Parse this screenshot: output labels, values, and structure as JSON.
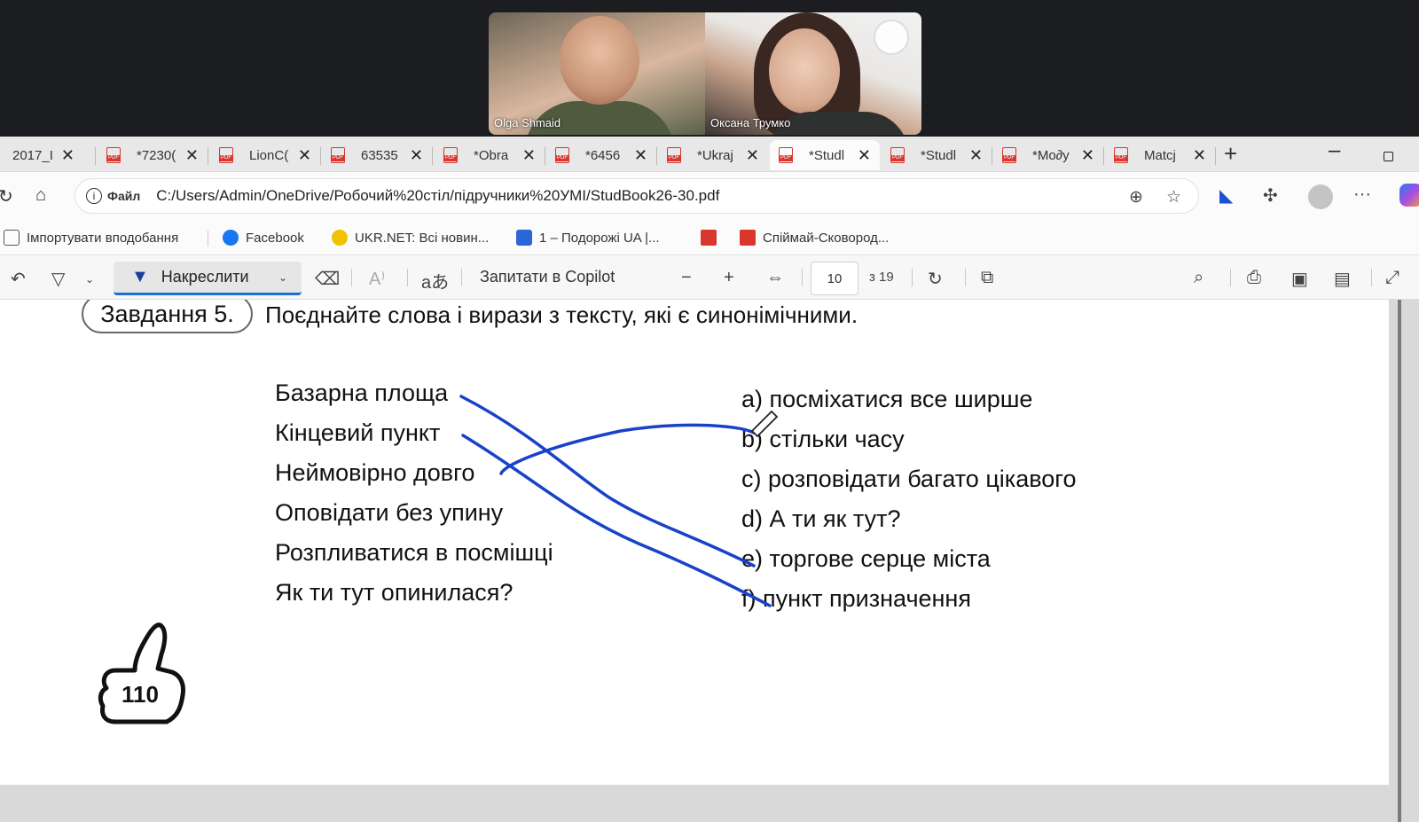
{
  "call": {
    "participants": [
      {
        "name": "Olga Shmaid"
      },
      {
        "name": "Оксана Трумко"
      }
    ]
  },
  "tabs": [
    {
      "label": "2017_І"
    },
    {
      "label": "*7230("
    },
    {
      "label": "LionC("
    },
    {
      "label": "63535"
    },
    {
      "label": "*Obra"
    },
    {
      "label": "*6456"
    },
    {
      "label": "*Ukraj"
    },
    {
      "label": "*Studl",
      "active": true
    },
    {
      "label": "*Studl"
    },
    {
      "label": "*Mo∂y"
    },
    {
      "label": "Matcj"
    }
  ],
  "address": {
    "file_label": "Файл",
    "url": "C:/Users/Admin/OneDrive/Робочий%20стіл/підручники%20УМІ/StudBook26-30.pdf"
  },
  "bookmarks": {
    "import": "Імпортувати вподобання",
    "facebook": "Facebook",
    "ukrnet": "UKR.NET: Всі новин...",
    "podorozhi": "1 – Подорожі UA |...",
    "spiimai": "Спіймай-Сковород..."
  },
  "pdf_toolbar": {
    "draw_label": "Накреслити",
    "copilot_label": "Запитати в Copilot",
    "page_current": "10",
    "page_total": "з 19"
  },
  "document": {
    "task_badge": "Завдання 5.",
    "task_text": "Поєднайте слова і вирази з тексту, які є синонімічними.",
    "left_items": [
      "Базарна площа",
      "Кінцевий пункт",
      "Неймовірно довго",
      "Оповідати без упину",
      "Розпливатися в посмішці",
      "Як ти тут опинилася?"
    ],
    "right_items": [
      "a) посміхатися все ширше",
      "b) стільки часу",
      "c) розповідати багато цікавого",
      "d) А ти як тут?",
      "e) торгове серце міста",
      "f) пункт призначення"
    ],
    "page_number": "110"
  },
  "colors": {
    "ink": "#1742c9",
    "active_underline": "#1a6fd1"
  }
}
